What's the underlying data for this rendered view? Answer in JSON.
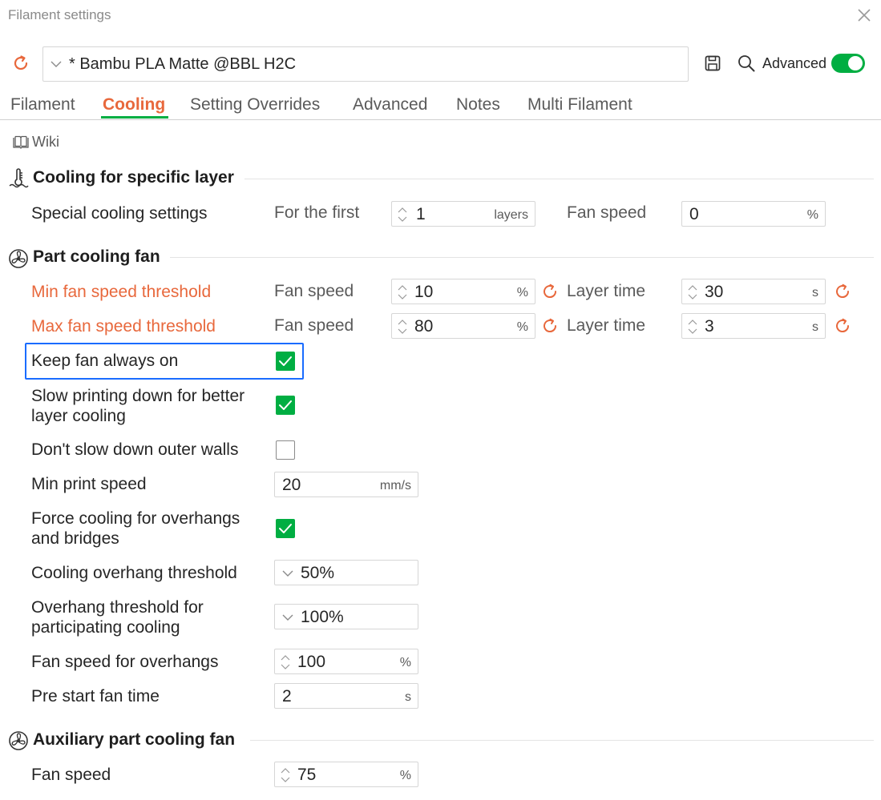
{
  "window": {
    "title": "Filament settings"
  },
  "preset": {
    "value": "* Bambu PLA Matte @BBL H2C"
  },
  "toolbar": {
    "advanced_label": "Advanced",
    "advanced_on": true
  },
  "tabs": [
    {
      "label": "Filament",
      "active": false
    },
    {
      "label": "Cooling",
      "active": true
    },
    {
      "label": "Setting Overrides",
      "active": false
    },
    {
      "label": "Advanced",
      "active": false
    },
    {
      "label": "Notes",
      "active": false
    },
    {
      "label": "Multi Filament",
      "active": false
    }
  ],
  "wiki": {
    "label": "Wiki"
  },
  "sections": {
    "specific_layer": {
      "title": "Cooling for specific layer",
      "special": {
        "label": "Special cooling settings",
        "for_first_label": "For the first",
        "layers_value": "1",
        "layers_unit": "layers",
        "fan_speed_label": "Fan speed",
        "fan_speed_value": "0",
        "fan_speed_unit": "%"
      }
    },
    "part_fan": {
      "title": "Part cooling fan",
      "min_threshold": {
        "label": "Min fan speed threshold",
        "fan_label": "Fan speed",
        "fan_value": "10",
        "fan_unit": "%",
        "layer_label": "Layer time",
        "layer_value": "30",
        "layer_unit": "s"
      },
      "max_threshold": {
        "label": "Max fan speed threshold",
        "fan_label": "Fan speed",
        "fan_value": "80",
        "fan_unit": "%",
        "layer_label": "Layer time",
        "layer_value": "3",
        "layer_unit": "s"
      },
      "keep_fan_on": {
        "label": "Keep fan always on",
        "checked": true
      },
      "slow_printing": {
        "label_line1": "Slow printing down for better",
        "label_line2": "layer cooling",
        "checked": true
      },
      "dont_slow_walls": {
        "label": "Don't slow down outer walls",
        "checked": false
      },
      "min_print_speed": {
        "label": "Min print speed",
        "value": "20",
        "unit": "mm/s"
      },
      "force_cooling": {
        "label_line1": "Force cooling for overhangs",
        "label_line2": "and bridges",
        "checked": true
      },
      "overhang_threshold": {
        "label": "Cooling overhang threshold",
        "value": "50%"
      },
      "participating_threshold": {
        "label_line1": "Overhang threshold for",
        "label_line2": "participating cooling",
        "value": "100%"
      },
      "fan_overhangs": {
        "label": "Fan speed for overhangs",
        "value": "100",
        "unit": "%"
      },
      "pre_start": {
        "label": "Pre start fan time",
        "value": "2",
        "unit": "s"
      }
    },
    "aux_fan": {
      "title": "Auxiliary part cooling fan",
      "fan_speed": {
        "label": "Fan speed",
        "value": "75",
        "unit": "%"
      }
    }
  },
  "colors": {
    "accent": "#e8683c",
    "green": "#00ae42",
    "highlight": "#1a6cff"
  }
}
